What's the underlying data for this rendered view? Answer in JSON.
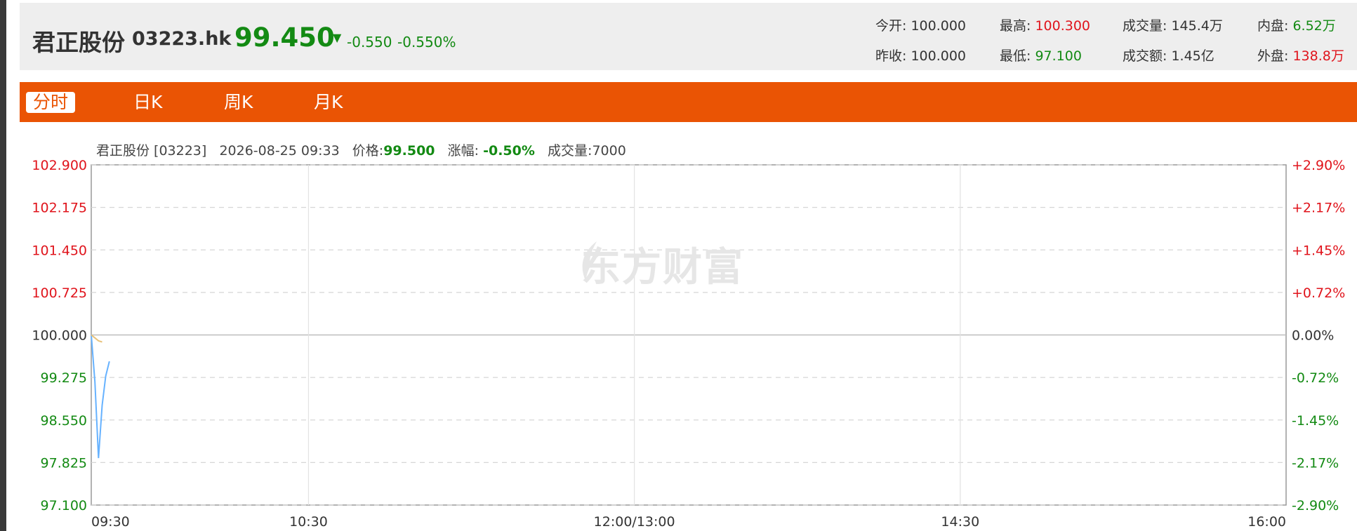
{
  "header": {
    "name": "君正股份",
    "code": "03223.hk",
    "price": "99.450",
    "price_arrow": "▼",
    "change": "-0.550",
    "change_pct": "-0.550%",
    "stats": {
      "open_label": "今开:",
      "open": "100.000",
      "prev_close_label": "昨收:",
      "prev_close": "100.000",
      "high_label": "最高:",
      "high": "100.300",
      "low_label": "最低:",
      "low": "97.100",
      "volume_label": "成交量:",
      "volume": "145.4万",
      "amount_label": "成交额:",
      "amount": "1.45亿",
      "inner_label": "内盘:",
      "inner": "6.52万",
      "outer_label": "外盘:",
      "outer": "138.8万"
    }
  },
  "tabs": [
    {
      "label": "分时",
      "active": true
    },
    {
      "label": "日K",
      "active": false
    },
    {
      "label": "周K",
      "active": false
    },
    {
      "label": "月K",
      "active": false
    }
  ],
  "info": {
    "name_code": "君正股份 [03223]",
    "datetime": "2026-08-25 09:33",
    "price_label": "价格:",
    "price": "99.500",
    "chg_label": "涨幅:",
    "chg": "-0.50%",
    "vol_label": "成交量:",
    "vol": "7000"
  },
  "watermark": "东方财富",
  "chart_data": {
    "type": "line",
    "title": "",
    "ylim": [
      97.1,
      102.9
    ],
    "y_ticks_left": [
      "102.900",
      "102.175",
      "101.450",
      "100.725",
      "100.000",
      "99.275",
      "98.550",
      "97.825",
      "97.100"
    ],
    "y_ticks_right": [
      "+2.90%",
      "+2.17%",
      "+1.45%",
      "+0.72%",
      "0.00%",
      "-0.72%",
      "-1.45%",
      "-2.17%",
      "-2.90%"
    ],
    "x_ticks": [
      "09:30",
      "10:30",
      "12:00/13:00",
      "14:30",
      "16:00"
    ],
    "x_minutes_total": 330,
    "x_tick_minutes": [
      0,
      60,
      150,
      240,
      330
    ],
    "baseline": 100.0,
    "grid": true,
    "series": [
      {
        "color": "#66b2ff",
        "points": [
          [
            0,
            100.0
          ],
          [
            1,
            99.2
          ],
          [
            2,
            97.9
          ],
          [
            3,
            98.8
          ],
          [
            4,
            99.3
          ],
          [
            5,
            99.55
          ]
        ]
      },
      {
        "color": "#e8c27a",
        "points": [
          [
            0,
            100.0
          ],
          [
            1,
            99.95
          ],
          [
            2,
            99.9
          ],
          [
            3,
            99.88
          ]
        ]
      }
    ],
    "colors": {
      "up": "#e0141c",
      "down": "#138a13",
      "flat": "#333333",
      "grid": "#d6d6d6",
      "axis": "#999999"
    }
  }
}
